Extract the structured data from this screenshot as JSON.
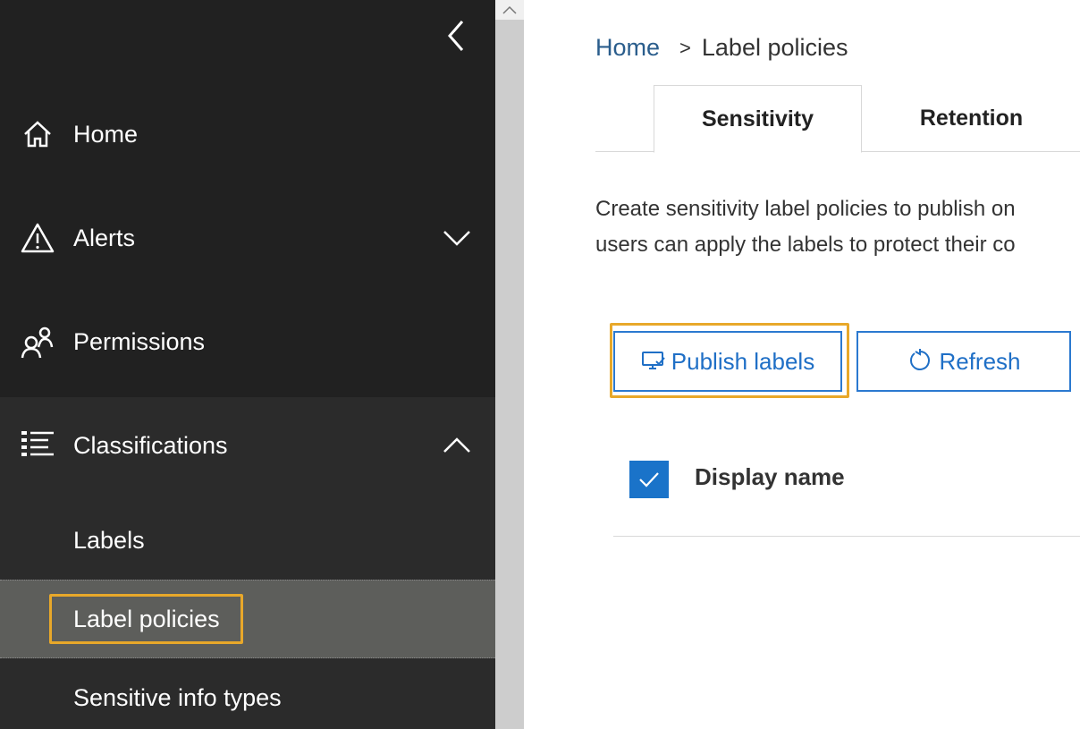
{
  "sidebar": {
    "items": [
      {
        "label": "Home",
        "icon": "home-icon"
      },
      {
        "label": "Alerts",
        "icon": "warning-icon",
        "chevron": "down"
      },
      {
        "label": "Permissions",
        "icon": "people-icon"
      },
      {
        "label": "Classifications",
        "icon": "list-icon",
        "chevron": "up"
      }
    ],
    "sub_items": [
      {
        "label": "Labels"
      },
      {
        "label": "Label policies",
        "selected": true
      },
      {
        "label": "Sensitive info types"
      }
    ]
  },
  "breadcrumb": {
    "home": "Home",
    "separator": ">",
    "current": "Label policies"
  },
  "tabs": [
    {
      "label": "Sensitivity",
      "active": true
    },
    {
      "label": "Retention",
      "active": false
    }
  ],
  "description": {
    "line1": "Create sensitivity label policies to publish on",
    "line2": "users can apply the labels to protect their co"
  },
  "toolbar": {
    "publish_label": "Publish labels",
    "refresh_label": "Refresh"
  },
  "table": {
    "columns": [
      "Display name"
    ],
    "select_all_checked": true
  },
  "colors": {
    "sidebar_bg": "#212121",
    "selected_bg": "#5d5e5b",
    "highlight": "#e8a82a",
    "accent": "#1f6fc6"
  }
}
